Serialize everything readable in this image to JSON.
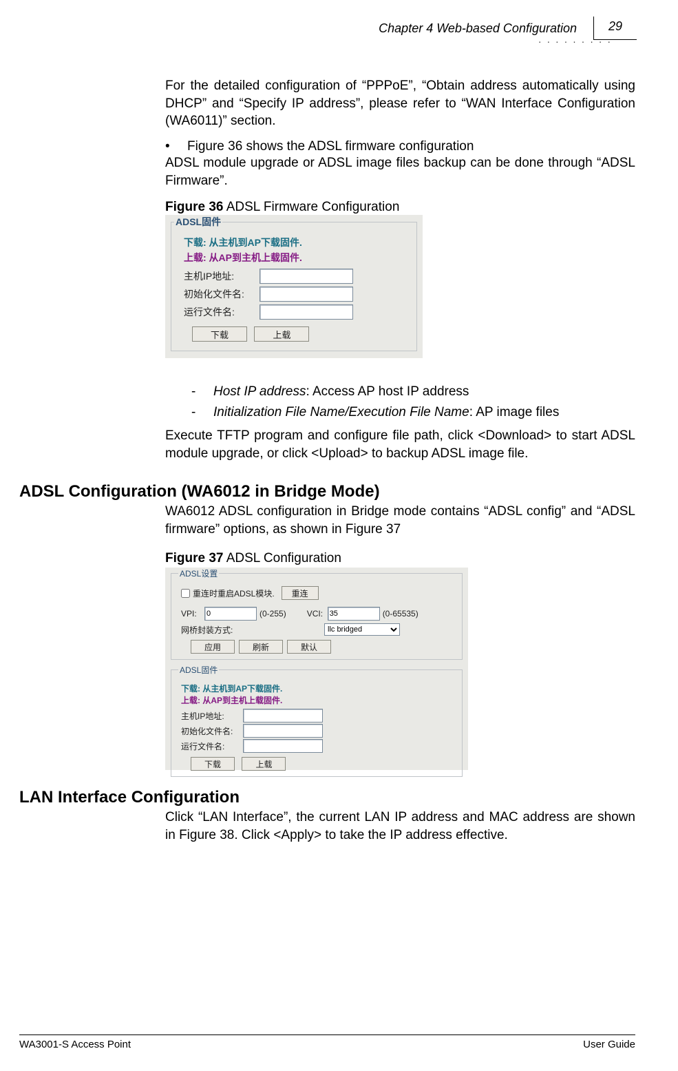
{
  "header": {
    "chapter": "Chapter 4 Web-based Configuration",
    "page_number": "29"
  },
  "para1": "For the detailed configuration of “PPPoE”, “Obtain address automatically using DHCP” and “Specify IP address”, please refer to “WAN Interface Configuration (WA6011)” section.",
  "bullet1": "Figure 36 shows the ADSL firmware configuration",
  "para2": "ADSL module upgrade or ADSL image files backup can be done through “ADSL Firmware”.",
  "fig36": {
    "caption_bold": "Figure 36",
    "caption_rest": " ADSL Firmware Configuration",
    "legend": "ADSL固件",
    "download_hint": "下载: 从主机到AP下载固件.",
    "upload_hint": "上载: 从AP到主机上载固件.",
    "host_ip_label": "主机IP地址:",
    "init_file_label": "初始化文件名:",
    "run_file_label": "运行文件名:",
    "download_btn": "下载",
    "upload_btn": "上载"
  },
  "def1": {
    "term": "Host IP address",
    "desc": ": Access AP host IP address"
  },
  "def2": {
    "term": "Initialization File Name/Execution File Name",
    "desc": ": AP image files"
  },
  "para3": "Execute TFTP program and configure file path, click <Download> to start ADSL module upgrade, or click <Upload> to backup ADSL image file.",
  "section_adsl_h2": "ADSL Configuration (WA6012 in Bridge Mode)",
  "para4": "WA6012 ADSL configuration in Bridge mode contains “ADSL config” and “ADSL firmware” options, as shown in Figure 37",
  "fig37": {
    "caption_bold": "Figure 37",
    "caption_rest": " ADSL Configuration",
    "fs1": {
      "legend": "ADSL设置",
      "checkbox_label": "重连时重启ADSL模块.",
      "reconnect_btn": "重连",
      "vpi_label": "VPI:",
      "vpi_value": "0",
      "vpi_range": "(0-255)",
      "vci_label": "VCI:",
      "vci_value": "35",
      "vci_range": "(0-65535)",
      "bridge_label": "网桥封装方式:",
      "bridge_select": "llc bridged",
      "apply_btn": "应用",
      "refresh_btn": "刷新",
      "default_btn": "默认"
    },
    "fs2": {
      "legend": "ADSL固件",
      "download_hint": "下载: 从主机到AP下载固件.",
      "upload_hint": "上载: 从AP到主机上载固件.",
      "host_ip_label": "主机IP地址:",
      "init_file_label": "初始化文件名:",
      "run_file_label": "运行文件名:",
      "download_btn": "下载",
      "upload_btn": "上载"
    }
  },
  "section_lan_h2": "LAN Interface Configuration",
  "para5": "Click “LAN Interface”, the current LAN IP address and MAC address are shown in Figure 38. Click <Apply> to take the IP address effective.",
  "footer": {
    "left": "WA3001-S Access Point",
    "right": "User Guide"
  }
}
